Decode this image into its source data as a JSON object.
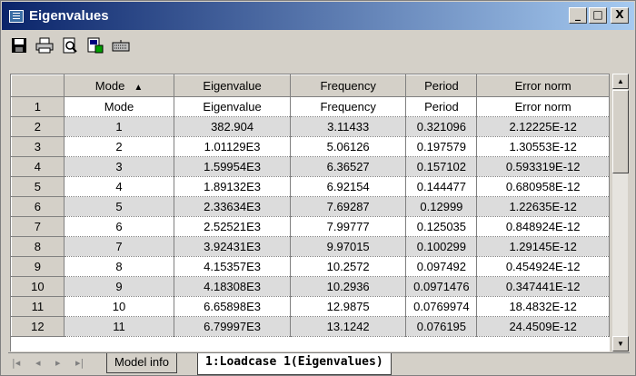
{
  "window": {
    "title": "Eigenvalues",
    "min_btn": "_",
    "max_btn": "□",
    "close_btn": "X"
  },
  "toolbar": {
    "buttons": [
      "save-icon",
      "print-icon",
      "print-preview-icon",
      "export-icon",
      "keyboard-icon"
    ]
  },
  "grid": {
    "columns": [
      "Mode",
      "Eigenvalue",
      "Frequency",
      "Period",
      "Error norm"
    ],
    "sort_indicator": "▲",
    "rows": [
      {
        "n": "1",
        "cells": [
          "Mode",
          "Eigenvalue",
          "Frequency",
          "Period",
          "Error norm"
        ]
      },
      {
        "n": "2",
        "cells": [
          "1",
          "382.904",
          "3.11433",
          "0.321096",
          "2.12225E-12"
        ]
      },
      {
        "n": "3",
        "cells": [
          "2",
          "1.01129E3",
          "5.06126",
          "0.197579",
          "1.30553E-12"
        ]
      },
      {
        "n": "4",
        "cells": [
          "3",
          "1.59954E3",
          "6.36527",
          "0.157102",
          "0.593319E-12"
        ]
      },
      {
        "n": "5",
        "cells": [
          "4",
          "1.89132E3",
          "6.92154",
          "0.144477",
          "0.680958E-12"
        ]
      },
      {
        "n": "6",
        "cells": [
          "5",
          "2.33634E3",
          "7.69287",
          "0.12999",
          "1.22635E-12"
        ]
      },
      {
        "n": "7",
        "cells": [
          "6",
          "2.52521E3",
          "7.99777",
          "0.125035",
          "0.848924E-12"
        ]
      },
      {
        "n": "8",
        "cells": [
          "7",
          "3.92431E3",
          "9.97015",
          "0.100299",
          "1.29145E-12"
        ]
      },
      {
        "n": "9",
        "cells": [
          "8",
          "4.15357E3",
          "10.2572",
          "0.097492",
          "0.454924E-12"
        ]
      },
      {
        "n": "10",
        "cells": [
          "9",
          "4.18308E3",
          "10.2936",
          "0.0971476",
          "0.347441E-12"
        ]
      },
      {
        "n": "11",
        "cells": [
          "10",
          "6.65898E3",
          "12.9875",
          "0.0769974",
          "18.4832E-12"
        ]
      },
      {
        "n": "12",
        "cells": [
          "11",
          "6.79997E3",
          "13.1242",
          "0.076195",
          "24.4509E-12"
        ]
      }
    ]
  },
  "tabs": {
    "nav": [
      "|◂",
      "◂",
      "▸",
      "▸|"
    ],
    "items": [
      "Model info",
      "1:Loadcase 1(Eigenvalues)"
    ],
    "active_index": 1
  },
  "colors": {
    "title_start": "#0a246a",
    "title_end": "#a6caf0",
    "chrome": "#d4d0c8",
    "alt_row": "#dcdcdc"
  }
}
